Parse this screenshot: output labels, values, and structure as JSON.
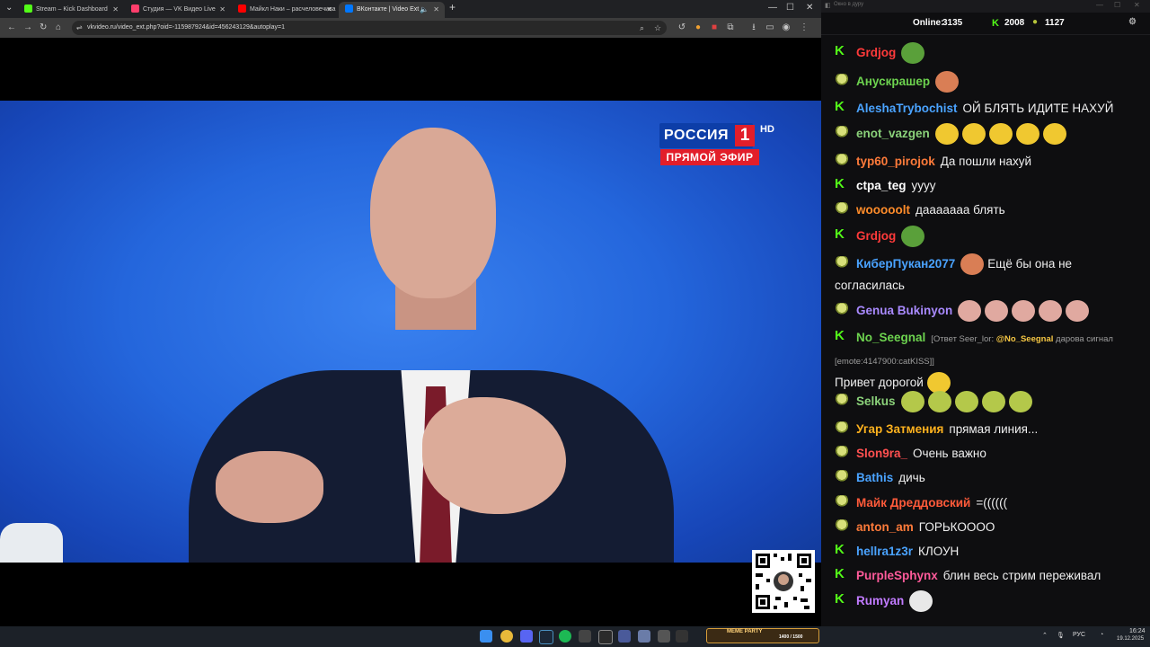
{
  "browser": {
    "tabs": [
      {
        "title": "Stream – Kick Dashboard",
        "color": "#53fc18"
      },
      {
        "title": "Студия — VK Видео Live",
        "color": "#ff3e6c"
      },
      {
        "title": "Майкл Наки – расчеловечива",
        "color": "#ff0000"
      },
      {
        "title": "ВКонтакте | Video Ext",
        "color": "#0077ff"
      }
    ],
    "new_tab": "+",
    "url": "vkvideo.ru/video_ext.php?oid=-115987924&id=456243129&autoplay=1"
  },
  "video": {
    "channel_name": "РОССИЯ",
    "channel_number": "1",
    "hd": "HD",
    "live_label": "ПРЯМОЙ ЭФИР"
  },
  "chat": {
    "window_title": "Окно в дуру",
    "online_label": "Online:",
    "online_count": "3135",
    "kick_count": "2008",
    "vk_count": "1127",
    "messages": [
      {
        "user": "Grdjog",
        "color": "#ff3a3a",
        "badge": "kick",
        "text": "",
        "emotes": 1
      },
      {
        "user": "Анускрашер",
        "color": "#6dd34f",
        "badge": "vk",
        "text": "",
        "emotes": 1
      },
      {
        "user": "AleshaTrybochist",
        "color": "#4aa3ff",
        "badge": "kick",
        "text": "ОЙ БЛЯТЬ ИДИТЕ НАХУЙ",
        "emotes": 0
      },
      {
        "user": "enot_vazgen",
        "color": "#8bd27a",
        "badge": "vk",
        "text": "",
        "emotes": 5
      },
      {
        "user": "typ60_pirojok",
        "color": "#ff7b3a",
        "badge": "vk",
        "text": "Да пошли нахуй",
        "emotes": 0
      },
      {
        "user": "ctpa_teg",
        "color": "#ffffff",
        "badge": "kick",
        "text": "yyyy",
        "emotes": 0
      },
      {
        "user": "wooooolt",
        "color": "#ff8c2a",
        "badge": "vk",
        "text": "дааааааа блять",
        "emotes": 0
      },
      {
        "user": "Grdjog",
        "color": "#ff3a3a",
        "badge": "kick",
        "text": "",
        "emotes": 1
      },
      {
        "user": "КиберПукан2077",
        "color": "#4aa3ff",
        "badge": "vk",
        "text": "Ещё бы она не согласилась",
        "emotes": 1
      },
      {
        "user": "Genua Bukinyon",
        "color": "#a98aff",
        "badge": "vk",
        "text": "",
        "emotes": 5
      },
      {
        "user": "No_Seegnal",
        "color": "#6dd34f",
        "badge": "kick",
        "reply_prefix": "[Ответ Seer_lor: ",
        "reply_mention": "@No_Seegnal",
        "reply_rest": " дарова сигнал [emote:4147900:catKISS]]",
        "text": "Привет дорогой",
        "emotes": 1
      },
      {
        "user": "Selkus",
        "color": "#8bd27a",
        "badge": "vk",
        "text": "",
        "emotes": 5
      },
      {
        "user": "Угар Затмения",
        "color": "#ffb21e",
        "badge": "vk",
        "text": "прямая линия...",
        "emotes": 0
      },
      {
        "user": "Slon9ra_",
        "color": "#ff5050",
        "badge": "vk",
        "text": "Очень важно",
        "emotes": 0
      },
      {
        "user": "Bathis",
        "color": "#4aa3ff",
        "badge": "vk",
        "text": "дичь",
        "emotes": 0
      },
      {
        "user": "Майк Дреддовский",
        "color": "#ff5a3a",
        "badge": "vk",
        "text": "=((((((",
        "emotes": 0
      },
      {
        "user": "anton_am",
        "color": "#ff7b3a",
        "badge": "vk",
        "text": "ГОРЬКОООО",
        "emotes": 0
      },
      {
        "user": "hellra1z3r",
        "color": "#4aa3ff",
        "badge": "kick",
        "text": "КЛОУН",
        "emotes": 0
      },
      {
        "user": "PurpleSphynx",
        "color": "#ff5a9a",
        "badge": "kick",
        "text": "блин весь стрим переживал",
        "emotes": 0
      },
      {
        "user": "Rumyan",
        "color": "#c17bff",
        "badge": "kick",
        "text": "",
        "emotes": 1
      }
    ]
  },
  "taskbar": {
    "meme_label": "MEME PARTY",
    "meme_progress": "1400 / 1500",
    "lang": "РУС",
    "time": "16:24",
    "date": "19.12.2025"
  }
}
